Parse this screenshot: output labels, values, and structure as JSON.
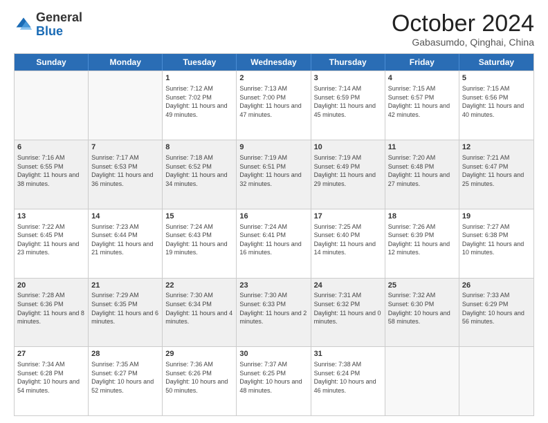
{
  "logo": {
    "general": "General",
    "blue": "Blue"
  },
  "header": {
    "title": "October 2024",
    "subtitle": "Gabasumdo, Qinghai, China"
  },
  "weekdays": [
    "Sunday",
    "Monday",
    "Tuesday",
    "Wednesday",
    "Thursday",
    "Friday",
    "Saturday"
  ],
  "weeks": [
    [
      {
        "day": "",
        "empty": true
      },
      {
        "day": "",
        "empty": true
      },
      {
        "day": "1",
        "sunrise": "Sunrise: 7:12 AM",
        "sunset": "Sunset: 7:02 PM",
        "daylight": "Daylight: 11 hours and 49 minutes."
      },
      {
        "day": "2",
        "sunrise": "Sunrise: 7:13 AM",
        "sunset": "Sunset: 7:00 PM",
        "daylight": "Daylight: 11 hours and 47 minutes."
      },
      {
        "day": "3",
        "sunrise": "Sunrise: 7:14 AM",
        "sunset": "Sunset: 6:59 PM",
        "daylight": "Daylight: 11 hours and 45 minutes."
      },
      {
        "day": "4",
        "sunrise": "Sunrise: 7:15 AM",
        "sunset": "Sunset: 6:57 PM",
        "daylight": "Daylight: 11 hours and 42 minutes."
      },
      {
        "day": "5",
        "sunrise": "Sunrise: 7:15 AM",
        "sunset": "Sunset: 6:56 PM",
        "daylight": "Daylight: 11 hours and 40 minutes."
      }
    ],
    [
      {
        "day": "6",
        "sunrise": "Sunrise: 7:16 AM",
        "sunset": "Sunset: 6:55 PM",
        "daylight": "Daylight: 11 hours and 38 minutes."
      },
      {
        "day": "7",
        "sunrise": "Sunrise: 7:17 AM",
        "sunset": "Sunset: 6:53 PM",
        "daylight": "Daylight: 11 hours and 36 minutes."
      },
      {
        "day": "8",
        "sunrise": "Sunrise: 7:18 AM",
        "sunset": "Sunset: 6:52 PM",
        "daylight": "Daylight: 11 hours and 34 minutes."
      },
      {
        "day": "9",
        "sunrise": "Sunrise: 7:19 AM",
        "sunset": "Sunset: 6:51 PM",
        "daylight": "Daylight: 11 hours and 32 minutes."
      },
      {
        "day": "10",
        "sunrise": "Sunrise: 7:19 AM",
        "sunset": "Sunset: 6:49 PM",
        "daylight": "Daylight: 11 hours and 29 minutes."
      },
      {
        "day": "11",
        "sunrise": "Sunrise: 7:20 AM",
        "sunset": "Sunset: 6:48 PM",
        "daylight": "Daylight: 11 hours and 27 minutes."
      },
      {
        "day": "12",
        "sunrise": "Sunrise: 7:21 AM",
        "sunset": "Sunset: 6:47 PM",
        "daylight": "Daylight: 11 hours and 25 minutes."
      }
    ],
    [
      {
        "day": "13",
        "sunrise": "Sunrise: 7:22 AM",
        "sunset": "Sunset: 6:45 PM",
        "daylight": "Daylight: 11 hours and 23 minutes."
      },
      {
        "day": "14",
        "sunrise": "Sunrise: 7:23 AM",
        "sunset": "Sunset: 6:44 PM",
        "daylight": "Daylight: 11 hours and 21 minutes."
      },
      {
        "day": "15",
        "sunrise": "Sunrise: 7:24 AM",
        "sunset": "Sunset: 6:43 PM",
        "daylight": "Daylight: 11 hours and 19 minutes."
      },
      {
        "day": "16",
        "sunrise": "Sunrise: 7:24 AM",
        "sunset": "Sunset: 6:41 PM",
        "daylight": "Daylight: 11 hours and 16 minutes."
      },
      {
        "day": "17",
        "sunrise": "Sunrise: 7:25 AM",
        "sunset": "Sunset: 6:40 PM",
        "daylight": "Daylight: 11 hours and 14 minutes."
      },
      {
        "day": "18",
        "sunrise": "Sunrise: 7:26 AM",
        "sunset": "Sunset: 6:39 PM",
        "daylight": "Daylight: 11 hours and 12 minutes."
      },
      {
        "day": "19",
        "sunrise": "Sunrise: 7:27 AM",
        "sunset": "Sunset: 6:38 PM",
        "daylight": "Daylight: 11 hours and 10 minutes."
      }
    ],
    [
      {
        "day": "20",
        "sunrise": "Sunrise: 7:28 AM",
        "sunset": "Sunset: 6:36 PM",
        "daylight": "Daylight: 11 hours and 8 minutes."
      },
      {
        "day": "21",
        "sunrise": "Sunrise: 7:29 AM",
        "sunset": "Sunset: 6:35 PM",
        "daylight": "Daylight: 11 hours and 6 minutes."
      },
      {
        "day": "22",
        "sunrise": "Sunrise: 7:30 AM",
        "sunset": "Sunset: 6:34 PM",
        "daylight": "Daylight: 11 hours and 4 minutes."
      },
      {
        "day": "23",
        "sunrise": "Sunrise: 7:30 AM",
        "sunset": "Sunset: 6:33 PM",
        "daylight": "Daylight: 11 hours and 2 minutes."
      },
      {
        "day": "24",
        "sunrise": "Sunrise: 7:31 AM",
        "sunset": "Sunset: 6:32 PM",
        "daylight": "Daylight: 11 hours and 0 minutes."
      },
      {
        "day": "25",
        "sunrise": "Sunrise: 7:32 AM",
        "sunset": "Sunset: 6:30 PM",
        "daylight": "Daylight: 10 hours and 58 minutes."
      },
      {
        "day": "26",
        "sunrise": "Sunrise: 7:33 AM",
        "sunset": "Sunset: 6:29 PM",
        "daylight": "Daylight: 10 hours and 56 minutes."
      }
    ],
    [
      {
        "day": "27",
        "sunrise": "Sunrise: 7:34 AM",
        "sunset": "Sunset: 6:28 PM",
        "daylight": "Daylight: 10 hours and 54 minutes."
      },
      {
        "day": "28",
        "sunrise": "Sunrise: 7:35 AM",
        "sunset": "Sunset: 6:27 PM",
        "daylight": "Daylight: 10 hours and 52 minutes."
      },
      {
        "day": "29",
        "sunrise": "Sunrise: 7:36 AM",
        "sunset": "Sunset: 6:26 PM",
        "daylight": "Daylight: 10 hours and 50 minutes."
      },
      {
        "day": "30",
        "sunrise": "Sunrise: 7:37 AM",
        "sunset": "Sunset: 6:25 PM",
        "daylight": "Daylight: 10 hours and 48 minutes."
      },
      {
        "day": "31",
        "sunrise": "Sunrise: 7:38 AM",
        "sunset": "Sunset: 6:24 PM",
        "daylight": "Daylight: 10 hours and 46 minutes."
      },
      {
        "day": "",
        "empty": true
      },
      {
        "day": "",
        "empty": true
      }
    ]
  ]
}
